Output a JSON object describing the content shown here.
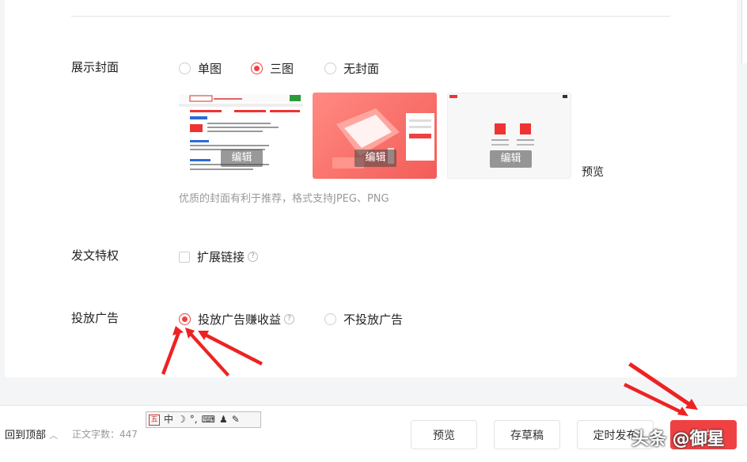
{
  "cover": {
    "label": "展示封面",
    "options": [
      "单图",
      "三图",
      "无封面"
    ],
    "selected": "三图",
    "edit_label": "编辑",
    "preview_label": "预览",
    "hint": "优质的封面有利于推荐，格式支持JPEG、PNG"
  },
  "privilege": {
    "label": "发文特权",
    "checkbox_label": "扩展链接",
    "checked": false
  },
  "ads": {
    "label": "投放广告",
    "options": [
      "投放广告赚收益",
      "不投放广告"
    ],
    "selected": "投放广告赚收益"
  },
  "footer": {
    "back_top": "回到顶部",
    "word_count": "正文字数：447",
    "preview": "预览",
    "draft": "存草稿",
    "timed": "定时发布",
    "publish": "发布"
  },
  "ime": {
    "logo": "五",
    "mode": "中"
  },
  "watermark": "头条 @御星",
  "colors": {
    "accent": "#f04142",
    "arrow": "#ee2222"
  },
  "icons": [
    "help-icon",
    "chevron-up-icon",
    "ime-moon-icon",
    "ime-punct-icon",
    "ime-keyboard-icon",
    "ime-user-icon",
    "ime-wrench-icon"
  ]
}
